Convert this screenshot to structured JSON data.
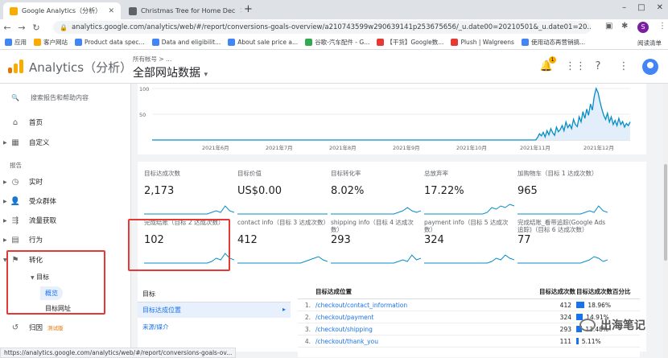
{
  "browser": {
    "tabs": [
      {
        "title": "Google Analytics（分析）"
      },
      {
        "title": "Christmas Tree for Home Dec"
      }
    ],
    "url": "analytics.google.com/analytics/web/#/report/conversions-goals-overview/a210743599w290639141p253675656/_u.date00=20210501&_u.date01=20...",
    "bookmarks": [
      "应用",
      "客户网站",
      "Product data spec...",
      "Data and eligibilit...",
      "About sale price a...",
      "谷歌-汽车配件 - G...",
      "【干货】Google数...",
      "Plush | Walgreens",
      "使用动态再营销搞..."
    ],
    "bookmarks_right": "阅读清单",
    "profile_initial": "S",
    "status_url": "https://analytics.google.com/analytics/web/#/report/conversions-goals-ov..."
  },
  "ga": {
    "title": "Analytics（分析）",
    "account_crumb": "所有帐号 > ...",
    "account_name": "全部网站数据",
    "notification_count": "1"
  },
  "sidebar": {
    "search_placeholder": "搜索报告和帮助内容",
    "home": "首页",
    "custom": "自定义",
    "reports_label": "报告",
    "realtime": "实时",
    "audience": "受众群体",
    "acquisition": "流量获取",
    "behavior": "行为",
    "conversions": "转化",
    "goals": "目标",
    "overview": "概览",
    "goal_urls": "目标网址",
    "attribution": "归因",
    "beta": "测试版"
  },
  "chart_data": {
    "type": "line",
    "y_ticks": [
      "100",
      "50"
    ],
    "x_ticks": [
      "2021年6月",
      "2021年7月",
      "2021年8月",
      "2021年9月",
      "2021年10月",
      "2021年11月",
      "2021年12月"
    ],
    "values": [
      0,
      0,
      0,
      0,
      0,
      0,
      0,
      0,
      0,
      0,
      0,
      0,
      0,
      0,
      0,
      0,
      0,
      0,
      0,
      0,
      0,
      0,
      0,
      0,
      0,
      0,
      0,
      0,
      0,
      0,
      0,
      0,
      0,
      0,
      0,
      0,
      0,
      0,
      0,
      0,
      0,
      0,
      0,
      0,
      0,
      0,
      0,
      0,
      0,
      0,
      0,
      0,
      0,
      0,
      0,
      0,
      0,
      0,
      0,
      0,
      0,
      0,
      0,
      0,
      0,
      0,
      0,
      0,
      0,
      0,
      0,
      0,
      0,
      0,
      0,
      0,
      0,
      0,
      0,
      0,
      0,
      0,
      0,
      0,
      0,
      0,
      0,
      0,
      0,
      0,
      0,
      0,
      0,
      0,
      0,
      0,
      0,
      0,
      0,
      0,
      0,
      0,
      0,
      0,
      0,
      0,
      0,
      0,
      0,
      0,
      0,
      0,
      0,
      0,
      0,
      0,
      0,
      0,
      0,
      0,
      0,
      0,
      0,
      0,
      0,
      0,
      0,
      0,
      0,
      0,
      0,
      0,
      0,
      0,
      0,
      0,
      0,
      0,
      0,
      0,
      0,
      0,
      0,
      0,
      0,
      0,
      0,
      0,
      0,
      0,
      0,
      0,
      0,
      0,
      0,
      0,
      0,
      0,
      0,
      0,
      0,
      0,
      0,
      0,
      0,
      0,
      0,
      0,
      0,
      0,
      0,
      0,
      0,
      0,
      0,
      0,
      0,
      0,
      0,
      0,
      0,
      0,
      0,
      0,
      0,
      0,
      0,
      0,
      0,
      0,
      0,
      0,
      0,
      0,
      0,
      0,
      0,
      0,
      0,
      0,
      0,
      0,
      0,
      0,
      5,
      12,
      8,
      15,
      6,
      18,
      10,
      22,
      14,
      9,
      25,
      16,
      20,
      28,
      18,
      35,
      24,
      30,
      22,
      40,
      30,
      26,
      45,
      35,
      55,
      42,
      60,
      48,
      70,
      58,
      85,
      100,
      92,
      75,
      60,
      48,
      40,
      52,
      35,
      45,
      30,
      38,
      28,
      42,
      30,
      36,
      25,
      32,
      28,
      35
    ]
  },
  "metrics": [
    {
      "label": "目标达成次数",
      "value": "2,173"
    },
    {
      "label": "目标价值",
      "value": "US$0.00"
    },
    {
      "label": "目标转化率",
      "value": "8.02%"
    },
    {
      "label": "总放弃率",
      "value": "17.22%"
    },
    {
      "label": "加购物车（目标 1 达成次数）",
      "value": "965"
    },
    {
      "label": "完成结账（目标 2 达成次数）",
      "value": "102"
    },
    {
      "label": "contact info（目标 3 达成次数）",
      "value": "412"
    },
    {
      "label": "shipping info（目标 4 达成次数）",
      "value": "293"
    },
    {
      "label": "payment info（目标 5 达成次数）",
      "value": "324"
    },
    {
      "label": "完成结账_看带追踪(Google Ads追踪)（目标 6 达成次数）",
      "value": "77"
    }
  ],
  "goals": {
    "left_header": "目标",
    "left_selected": "目标达成位置",
    "left_link": "来源/媒介",
    "col_location": "目标达成位置",
    "col_count": "目标达成次数",
    "col_pct": "目标达成次数百分比",
    "rows": [
      {
        "num": "1.",
        "url": "/checkout/contact_information",
        "count": "412",
        "pct": "18.96%"
      },
      {
        "num": "2.",
        "url": "/checkout/payment",
        "count": "324",
        "pct": "14.91%"
      },
      {
        "num": "3.",
        "url": "/checkout/shipping",
        "count": "293",
        "pct": "13.48%"
      },
      {
        "num": "4.",
        "url": "/checkout/thank_you",
        "count": "111",
        "pct": "5.11%"
      }
    ]
  },
  "watermark": "出海笔记"
}
